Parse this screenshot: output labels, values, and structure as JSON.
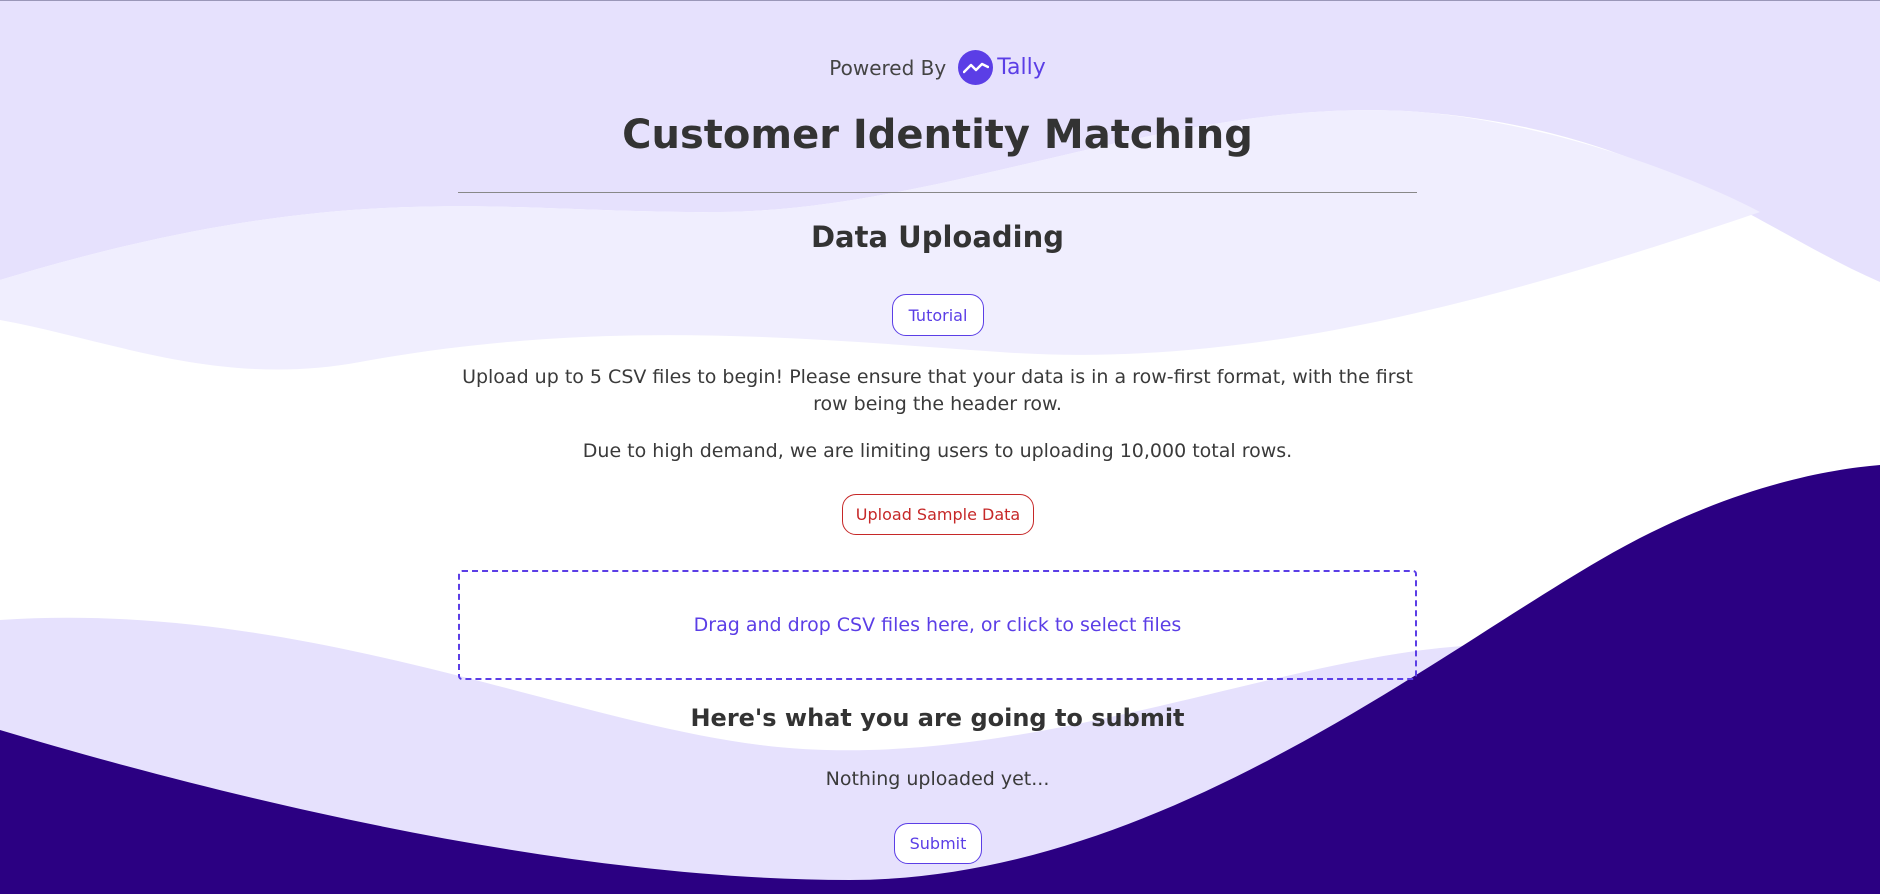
{
  "header": {
    "powered_by_label": "Powered By",
    "brand_name": "Tally",
    "title": "Customer Identity Matching"
  },
  "section": {
    "title": "Data Uploading",
    "tutorial_button_label": "Tutorial",
    "instructions": "Upload up to 5 CSV files to begin! Please ensure that your data is in a row-first format, with the first row being the header row.",
    "limit_notice": "Due to high demand, we are limiting users to uploading 10,000 total rows.",
    "sample_button_label": "Upload Sample Data",
    "dropzone_text": "Drag and drop CSV files here, or click to select files"
  },
  "submission": {
    "title": "Here's what you are going to submit",
    "empty_text": "Nothing uploaded yet...",
    "submit_button_label": "Submit"
  },
  "colors": {
    "accent": "#5b3ee6",
    "danger": "#c62828",
    "wave_light": "#e6e1fd",
    "wave_lighter": "#f0eefe",
    "wave_dark": "#2b0082"
  },
  "icons": {
    "brand_logo": "tally-logo-icon"
  }
}
